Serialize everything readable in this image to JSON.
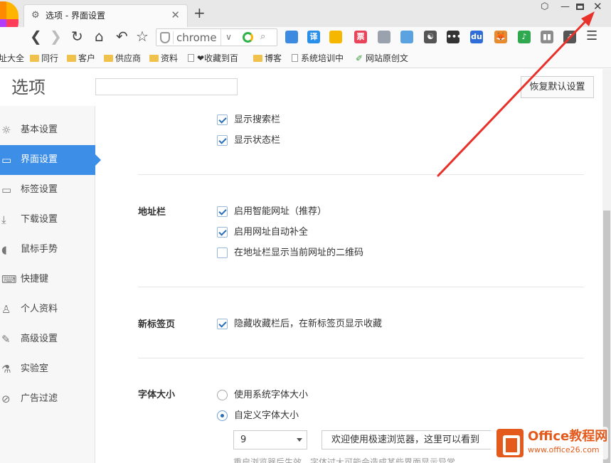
{
  "browser": {
    "tab": {
      "title": "选项 - 界面设置",
      "close": "✕"
    },
    "new_tab": "+",
    "window_controls": {
      "skin": "⬡",
      "minimize": "—",
      "close": "✕"
    },
    "toolbar": {
      "back": "❮",
      "forward": "❯",
      "reload": "↻",
      "home": "⌂",
      "undo": "↶",
      "star": "☆",
      "address_text": "chrome",
      "address_dropdown": "∨",
      "address_search": "🔍",
      "menu": "☰"
    },
    "extensions": [
      {
        "name": "windows-icon",
        "text": "",
        "color": "#3c8be0"
      },
      {
        "name": "translate-icon",
        "text": "译",
        "color": "#2a8fe8"
      },
      {
        "name": "shield-ext-icon",
        "text": "",
        "color": "#f5b700"
      },
      {
        "name": "ticket-icon",
        "text": "票",
        "color": "#e8455a"
      },
      {
        "name": "globe-icon",
        "text": "",
        "color": "#9aa3ad"
      },
      {
        "name": "screenshot-icon",
        "text": "",
        "color": "#5aa3e0"
      },
      {
        "name": "yinyang-icon",
        "text": "☯",
        "color": "#555555"
      },
      {
        "name": "chat-icon",
        "text": "•••",
        "color": "#333333"
      },
      {
        "name": "baidu-icon",
        "text": "du",
        "color": "#2f6ed8"
      },
      {
        "name": "fox-icon",
        "text": "🦊",
        "color": "#e88b2e"
      },
      {
        "name": "music-icon",
        "text": "♪",
        "color": "#2fa84f"
      },
      {
        "name": "reader-icon",
        "text": "▮▮",
        "color": "#8c8c8c"
      },
      {
        "name": "arrow-ext-icon",
        "text": "↗",
        "color": "#555555"
      }
    ]
  },
  "bookmarks": [
    {
      "label": "址大全",
      "type": "text"
    },
    {
      "label": "同行",
      "type": "folder"
    },
    {
      "label": "客户",
      "type": "folder"
    },
    {
      "label": "供应商",
      "type": "folder"
    },
    {
      "label": "资料",
      "type": "folder"
    },
    {
      "label": "❤收藏到百",
      "type": "page"
    },
    {
      "label": "博客",
      "type": "folder"
    },
    {
      "label": "系统培训中",
      "type": "page"
    },
    {
      "label": "网站原创文",
      "type": "leaf"
    }
  ],
  "options": {
    "title": "选项",
    "search_placeholder": "",
    "restore_button": "恢复默认设置",
    "sidebar": [
      {
        "label": "基本设置",
        "icon": "☼",
        "active": false
      },
      {
        "label": "界面设置",
        "icon": "▭",
        "active": true
      },
      {
        "label": "标签设置",
        "icon": "▭",
        "active": false
      },
      {
        "label": "下载设置",
        "icon": "⤓",
        "active": false
      },
      {
        "label": "鼠标手势",
        "icon": "◖",
        "active": false
      },
      {
        "label": "快捷键",
        "icon": "⌨",
        "active": false
      },
      {
        "label": "个人资料",
        "icon": "♙",
        "active": false
      },
      {
        "label": "高级设置",
        "icon": "✎",
        "active": false
      },
      {
        "label": "实验室",
        "icon": "⚗",
        "active": false
      },
      {
        "label": "广告过滤",
        "icon": "⊘",
        "active": false
      }
    ],
    "sections": {
      "toolbar_opts": [
        {
          "label": "显示搜索栏",
          "checked": true
        },
        {
          "label": "显示状态栏",
          "checked": true
        }
      ],
      "address_bar": {
        "label": "地址栏",
        "options": [
          {
            "label": "启用智能网址（推荐）",
            "checked": true
          },
          {
            "label": "启用网址自动补全",
            "checked": true
          },
          {
            "label": "在地址栏显示当前网址的二维码",
            "checked": false
          }
        ]
      },
      "new_tab": {
        "label": "新标签页",
        "options": [
          {
            "label": "隐藏收藏栏后，在新标签页显示收藏",
            "checked": true
          }
        ]
      },
      "font_size": {
        "label": "字体大小",
        "options": [
          {
            "label": "使用系统字体大小",
            "checked": false
          },
          {
            "label": "自定义字体大小",
            "checked": true
          }
        ],
        "size_value": "9",
        "preview_text": "欢迎使用极速浏览器，这里可以看到",
        "note": "重启浏览器后生效，字体过大可能会造成某些界面显示异常"
      }
    }
  },
  "watermark": {
    "brand": "Office教程网",
    "url": "www.office26.com"
  },
  "colors": {
    "accent": "#3d8ee6",
    "arrow": "#e8312a",
    "watermark": "#e35a1c"
  }
}
